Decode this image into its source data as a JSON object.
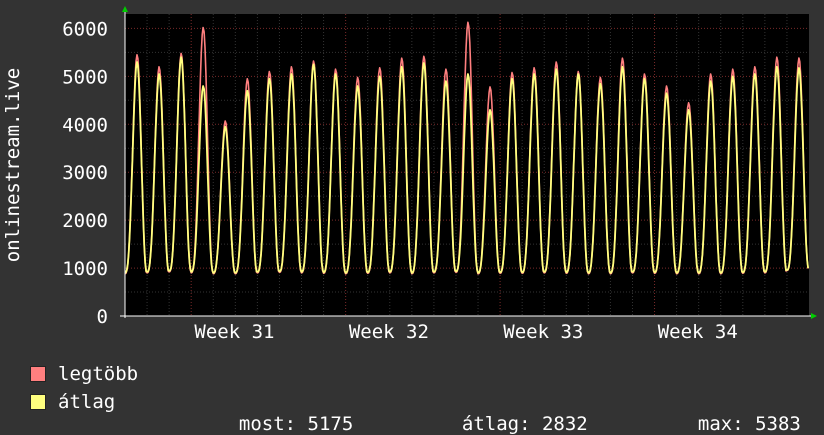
{
  "chart_data": {
    "type": "line",
    "ylabel": "onlinestream.live",
    "ylim": [
      0,
      6300
    ],
    "yticks": [
      0,
      1000,
      2000,
      3000,
      4000,
      5000,
      6000
    ],
    "ytick_labels": [
      "0",
      "1000",
      "2000",
      "3000",
      "4000",
      "5000",
      "6000"
    ],
    "xtick_labels": [
      "Week 31",
      "Week 32",
      "Week 33",
      "Week 34"
    ],
    "days": 31,
    "grid": true,
    "colors": {
      "background": "#333333",
      "plot_background": "#000000",
      "grid_minor": "#333333",
      "grid_major": "#7a2a2a",
      "axis": "#ffffff",
      "max_series": "#ff7f7f",
      "avg_series": "#ffff7f"
    },
    "series": [
      {
        "name": "legtöbb",
        "color": "#ff7f7f",
        "daily_peaks": [
          5450,
          5200,
          5480,
          6020,
          4070,
          4950,
          5100,
          5200,
          5320,
          5150,
          4980,
          5180,
          5380,
          5420,
          5150,
          6130,
          4780,
          5080,
          5180,
          5300,
          5100,
          4980,
          5380,
          5050,
          4800,
          4450,
          5050,
          5150,
          5200,
          5400,
          5383
        ],
        "daily_troughs": [
          880,
          900,
          920,
          900,
          880,
          880,
          900,
          910,
          900,
          890,
          880,
          890,
          900,
          880,
          900,
          910,
          880,
          890,
          890,
          900,
          890,
          880,
          880,
          900,
          890,
          880,
          880,
          880,
          890,
          900,
          950
        ]
      },
      {
        "name": "átlag",
        "color": "#ffff7f",
        "daily_peaks": [
          5300,
          5050,
          5400,
          4800,
          3950,
          4700,
          4950,
          5050,
          5250,
          5050,
          4800,
          5000,
          5200,
          5280,
          4900,
          5050,
          4300,
          4950,
          5050,
          5150,
          5050,
          4850,
          5200,
          4950,
          4650,
          4300,
          4900,
          5000,
          5050,
          5200,
          5175
        ],
        "daily_troughs": [
          900,
          920,
          940,
          920,
          900,
          900,
          920,
          930,
          920,
          910,
          900,
          910,
          920,
          900,
          920,
          930,
          900,
          910,
          910,
          920,
          910,
          900,
          900,
          920,
          910,
          900,
          900,
          900,
          910,
          920,
          960
        ]
      }
    ],
    "legend": [
      {
        "label": "legtöbb",
        "color": "#ff7f7f"
      },
      {
        "label": "átlag",
        "color": "#ffff7f"
      }
    ],
    "stats": {
      "now_label": "most:",
      "now_value": "5175",
      "avg_label": "átlag:",
      "avg_value": "2832",
      "max_label": "max:",
      "max_value": "5383"
    }
  }
}
